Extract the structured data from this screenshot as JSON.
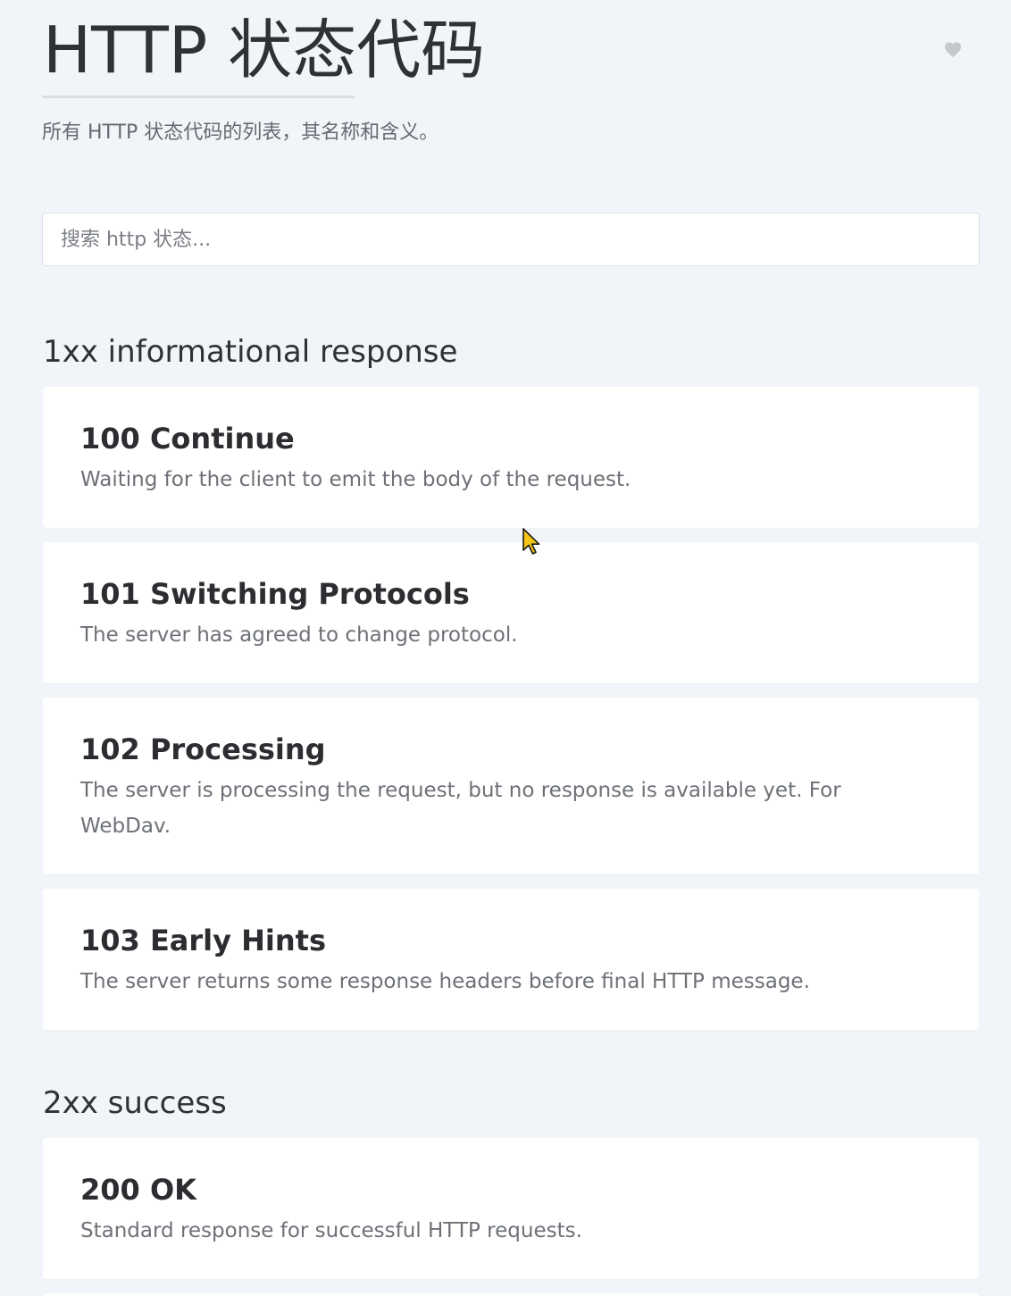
{
  "header": {
    "title": "HTTP 状态代码",
    "subtitle": "所有 HTTP 状态代码的列表，其名称和含义。"
  },
  "search": {
    "placeholder": "搜索 http 状态..."
  },
  "favorite": {
    "icon": "heart-icon",
    "color": "#c4c7cc"
  },
  "sections": [
    {
      "heading": "1xx informational response",
      "items": [
        {
          "title": "100 Continue",
          "description": "Waiting for the client to emit the body of the request."
        },
        {
          "title": "101 Switching Protocols",
          "description": "The server has agreed to change protocol."
        },
        {
          "title": "102 Processing",
          "description": "The server is processing the request, but no response is available yet. For WebDav."
        },
        {
          "title": "103 Early Hints",
          "description": "The server returns some response headers before final HTTP message."
        }
      ]
    },
    {
      "heading": "2xx success",
      "items": [
        {
          "title": "200 OK",
          "description": "Standard response for successful HTTP requests."
        }
      ]
    }
  ],
  "colors": {
    "background": "#f1f4f8",
    "card": "#ffffff",
    "title_text": "#2b2d30",
    "muted_text": "#6d7177"
  }
}
